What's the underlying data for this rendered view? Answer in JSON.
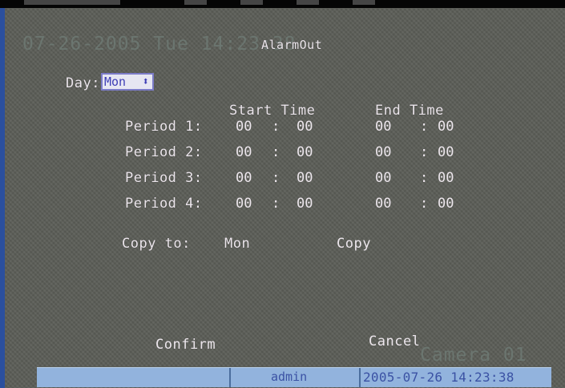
{
  "overlay": {
    "datetime": "07-26-2005 Tue 14:23:38",
    "camera": "Camera 01"
  },
  "dialog": {
    "title": "AlarmOut",
    "day_label": "Day:",
    "day_value": "Mon",
    "start_header": "Start Time",
    "end_header": "End Time",
    "periods": [
      {
        "label": "Period 1:",
        "start_h": "00",
        "start_m": "00",
        "end_h": "00",
        "end_m": "00"
      },
      {
        "label": "Period 2:",
        "start_h": "00",
        "start_m": "00",
        "end_h": "00",
        "end_m": "00"
      },
      {
        "label": "Period 3:",
        "start_h": "00",
        "start_m": "00",
        "end_h": "00",
        "end_m": "00"
      },
      {
        "label": "Period 4:",
        "start_h": "00",
        "start_m": "00",
        "end_h": "00",
        "end_m": "00"
      }
    ],
    "copy_to_label": "Copy to:",
    "copy_to_value": "Mon",
    "copy_button": "Copy",
    "confirm_button": "Confirm",
    "cancel_button": "Cancel"
  },
  "status_bar": {
    "user": "admin",
    "datetime": "2005-07-26 14:23:38"
  },
  "colors": {
    "background": "#5b5d57",
    "text": "#ece6ec",
    "status_bar": "#92b3dd",
    "status_text": "#3b52a4",
    "selection": "#3e3eb6"
  }
}
